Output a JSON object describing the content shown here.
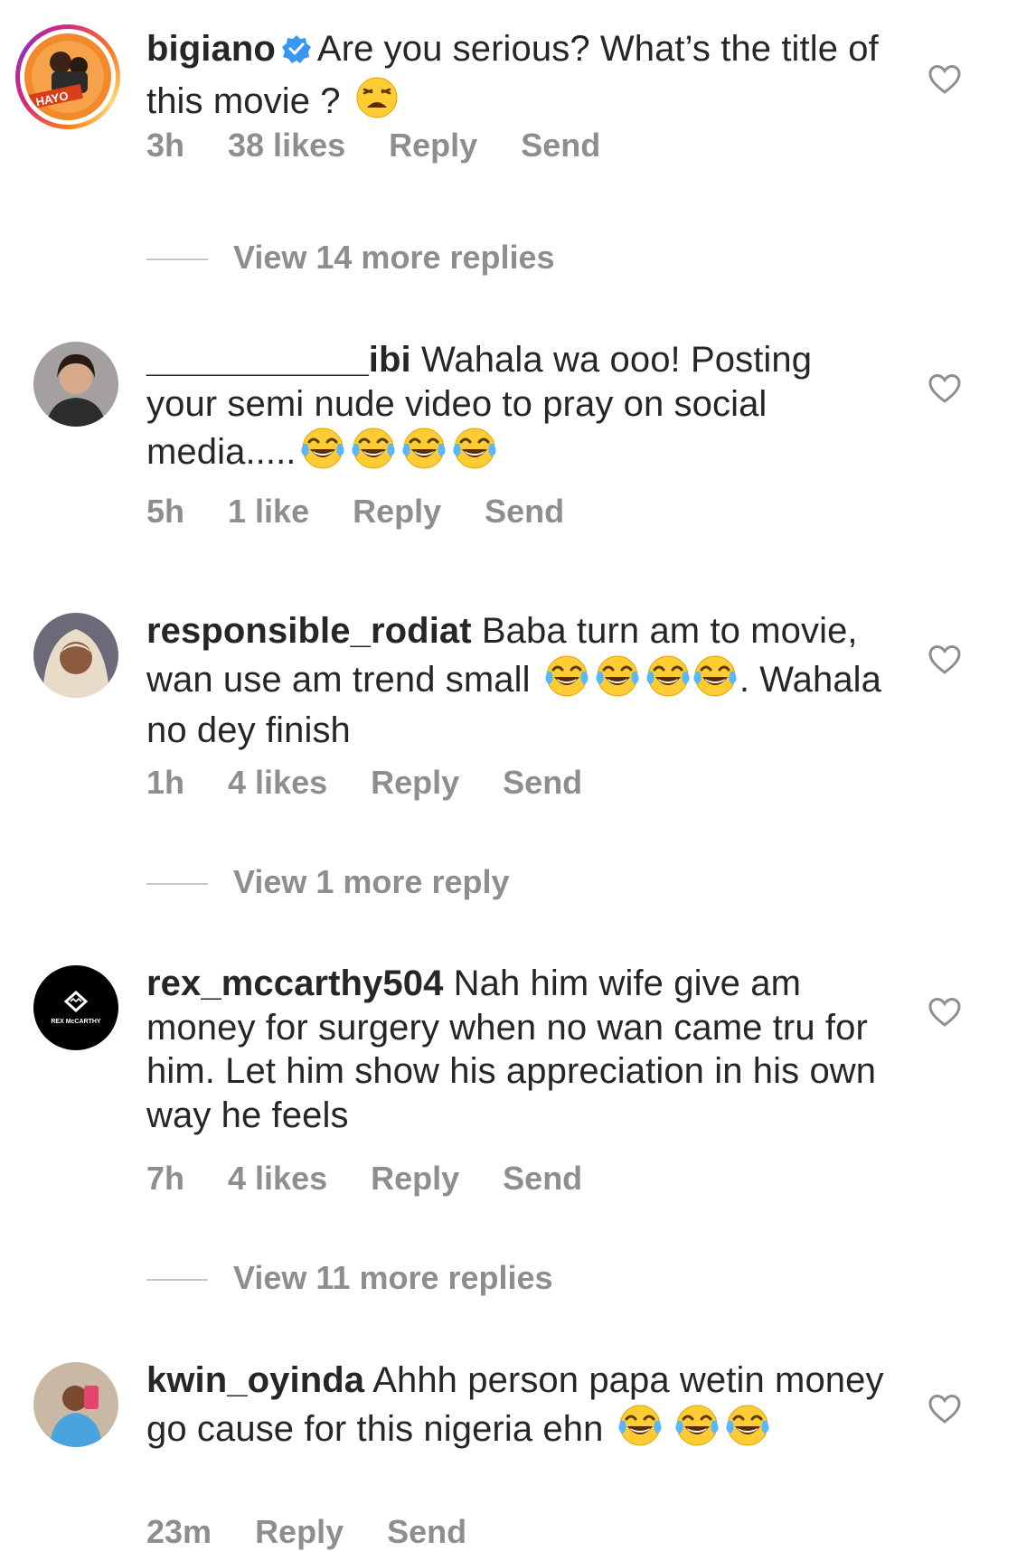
{
  "comments": [
    {
      "username": "bigiano",
      "verified": true,
      "text": "Are you serious? What’s the title of this movie ?",
      "emoji": [
        "weary-face"
      ],
      "time": "3h",
      "likes": "38 likes",
      "reply": "Reply",
      "send": "Send",
      "more_replies": "View 14 more replies"
    },
    {
      "username": "___________ibi",
      "text": "Wahala wa ooo! Posting your semi nude video to pray on social media.....",
      "emoji": [
        "tears-of-joy",
        "tears-of-joy",
        "tears-of-joy",
        "tears-of-joy"
      ],
      "time": "5h",
      "likes": "1 like",
      "reply": "Reply",
      "send": "Send"
    },
    {
      "username": "responsible_rodiat",
      "text_a": "Baba turn am to movie, wan use am trend small",
      "text_b": ". Wahala no dey finish",
      "emoji": [
        "tears-of-joy",
        "tears-of-joy",
        "tears-of-joy",
        "tears-of-joy"
      ],
      "time": "1h",
      "likes": "4 likes",
      "reply": "Reply",
      "send": "Send",
      "more_replies": "View 1 more reply"
    },
    {
      "username": "rex_mccarthy504",
      "text": "Nah him wife give am money for surgery when no wan came tru for him. Let him show his appreciation in his own way he feels",
      "time": "7h",
      "likes": "4 likes",
      "reply": "Reply",
      "send": "Send",
      "more_replies": "View 11 more replies",
      "avatar_text": "REX McCARTHY"
    },
    {
      "username": "kwin_oyinda",
      "text": "Ahhh person papa wetin money go cause for this nigeria ehn",
      "emoji": [
        "tears-of-joy",
        "tears-of-joy",
        "tears-of-joy"
      ],
      "time": "23m",
      "reply": "Reply",
      "send": "Send"
    }
  ],
  "icons": {
    "heart": "heart-outline-icon",
    "verified": "verified-badge-icon"
  },
  "colors": {
    "text": "#262626",
    "secondary": "#8e8e8e",
    "verified": "#3897f0"
  },
  "avatars": {
    "bigiano_logo": "HAYO"
  }
}
